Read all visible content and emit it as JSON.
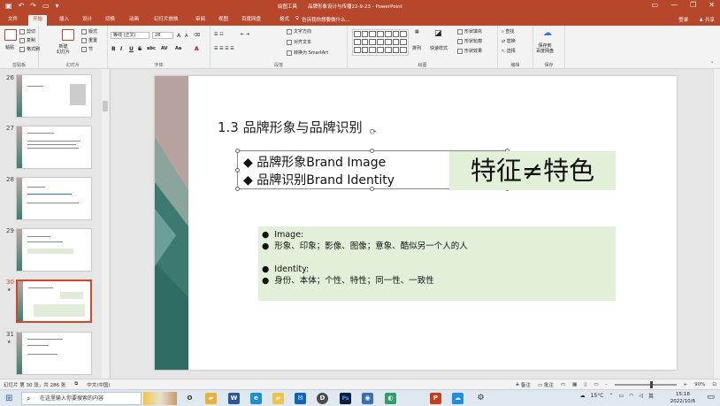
{
  "window": {
    "title": "品牌形象设计与传播22-9-23 - PowerPoint",
    "contextual_tools": "绘图工具",
    "qa_icons": [
      "save-icon",
      "undo-icon",
      "redo-icon",
      "present-icon"
    ],
    "controls": {
      "minimize": "—",
      "restore": "❐",
      "close": "✕"
    }
  },
  "tabs": [
    {
      "label": "文件"
    },
    {
      "label": "开始"
    },
    {
      "label": "插入"
    },
    {
      "label": "设计"
    },
    {
      "label": "切换"
    },
    {
      "label": "动画"
    },
    {
      "label": "幻灯片放映"
    },
    {
      "label": "审阅"
    },
    {
      "label": "视图"
    },
    {
      "label": "百度网盘"
    },
    {
      "label": "格式"
    }
  ],
  "tellme": "告诉我你想要做什么...",
  "account": {
    "login": "登录",
    "share": "共享"
  },
  "ribbon": {
    "clipboard": {
      "paste": "粘贴",
      "cut": "剪切",
      "copy": "复制",
      "painter": "格式刷",
      "label": "剪贴板"
    },
    "slides": {
      "new_slide": "新建\n幻灯片",
      "layout": "版式",
      "reset": "重置",
      "section": "节",
      "label": "幻灯片"
    },
    "font": {
      "font_name": "等线 (正文)",
      "font_size": "28",
      "bold": "B",
      "italic": "I",
      "underline": "U",
      "strike": "S",
      "shadow": "abc",
      "spacing": "AV",
      "case": "Aa",
      "color": "A",
      "grow": "A",
      "shrink": "A",
      "label": "字体"
    },
    "paragraph": {
      "text_dir": "文字方向",
      "align_text": "对齐文本",
      "smartart": "转换为 SmartArt",
      "label": "段落"
    },
    "drawing": {
      "arrange": "排列",
      "quick_styles": "快速样式",
      "fill": "形状填充",
      "outline": "形状轮廓",
      "effects": "形状效果",
      "label": "绘图"
    },
    "editing": {
      "find": "查找",
      "replace": "替换",
      "select": "选择",
      "label": "编辑"
    },
    "save": {
      "save_baidu": "保存到\n百度网盘",
      "label": "保存"
    }
  },
  "thumbnails": [
    {
      "num": "26",
      "star": ""
    },
    {
      "num": "27",
      "star": ""
    },
    {
      "num": "28",
      "star": ""
    },
    {
      "num": "29",
      "star": ""
    },
    {
      "num": "30",
      "star": "★"
    },
    {
      "num": "31",
      "star": "★"
    }
  ],
  "slide": {
    "title": "1.3 品牌形象与品牌识别",
    "bullets": [
      "品牌形象Brand Image",
      "品牌识别Brand Identity"
    ],
    "bullet_glyph": "◆",
    "callout": "特征≠特色",
    "notes": [
      {
        "glyph": "●",
        "text": "Image:"
      },
      {
        "glyph": "●",
        "text": "形象、印象；影像、图像；意象、酷似另一个人的人"
      },
      {
        "glyph": "●",
        "text": "Identity:"
      },
      {
        "glyph": "●",
        "text": "身份、本体；个性、特性；同一性、一致性"
      }
    ]
  },
  "status": {
    "slide_of": "幻灯片 第 30 张，共 286 张",
    "language": "中文(中国)",
    "notes_btn": "备注",
    "comments_btn": "批注",
    "zoom": "90%"
  },
  "taskbar": {
    "search_placeholder": "在这里输入你要搜索的内容",
    "temperature": "15°C",
    "ime": "英",
    "time": "15:18",
    "date": "2022/10/6",
    "apps": [
      {
        "name": "task-view",
        "label": "O",
        "color": "#dfe7ef"
      },
      {
        "name": "file-explorer",
        "label": "▰",
        "color": "#e8b23a"
      },
      {
        "name": "word",
        "label": "W",
        "color": "#2b579a"
      },
      {
        "name": "edge",
        "label": "e",
        "color": "#1a8fd4"
      },
      {
        "name": "folder",
        "label": "▰",
        "color": "#f0c14b"
      },
      {
        "name": "mail",
        "label": "✉",
        "color": "#0a64c0"
      },
      {
        "name": "dell",
        "label": "D",
        "color": "#4c4c4c"
      },
      {
        "name": "photoshop",
        "label": "Ps",
        "color": "#0b1e3b"
      },
      {
        "name": "app-blue",
        "label": "◉",
        "color": "#3a6fb5"
      },
      {
        "name": "app-green",
        "label": "◐",
        "color": "#2f9e6b"
      },
      {
        "name": "powerpoint",
        "label": "P",
        "color": "#c43e1c"
      },
      {
        "name": "app-cloud",
        "label": "☁",
        "color": "#1f8de2"
      },
      {
        "name": "settings",
        "label": "⚙",
        "color": "#dfe7ef"
      }
    ]
  }
}
